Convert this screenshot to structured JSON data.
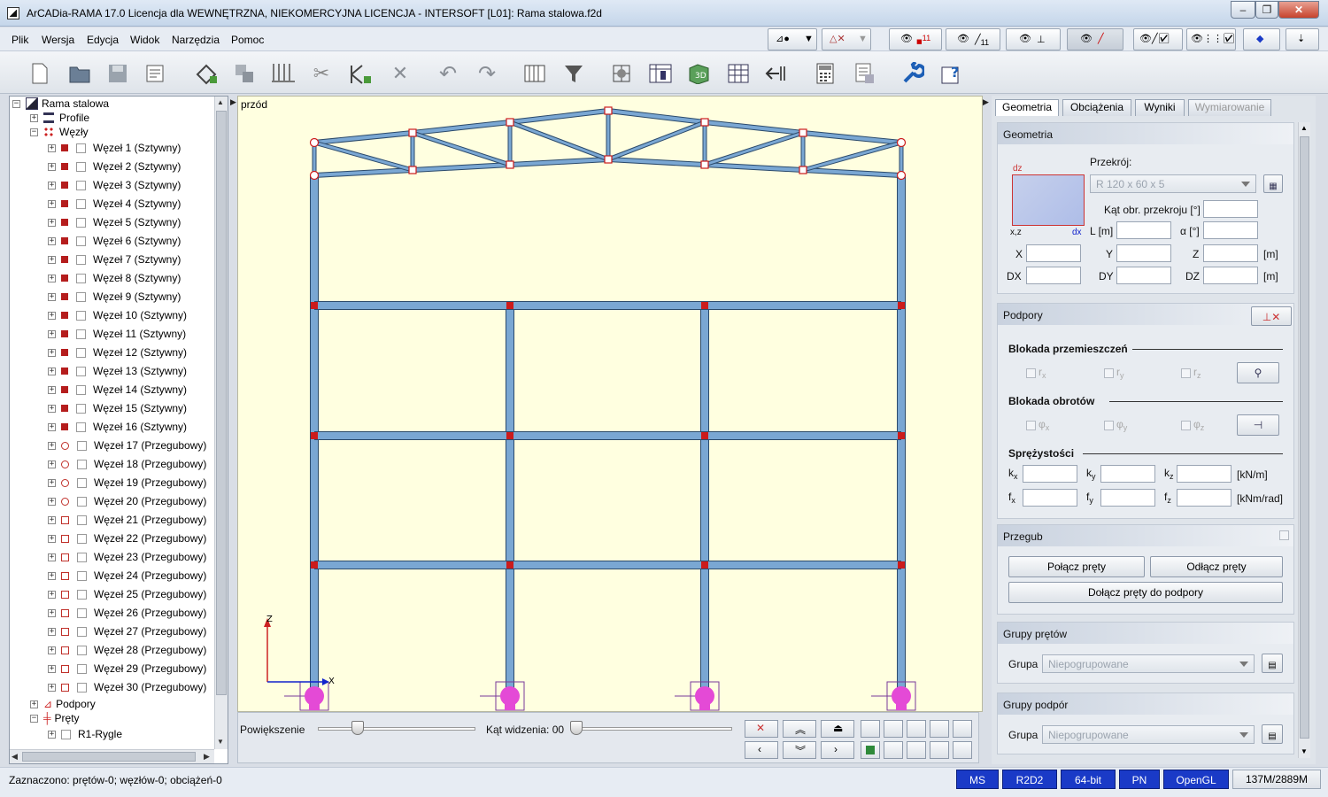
{
  "window": {
    "title": "ArCADia-RAMA 17.0 Licencja dla WEWNĘTRZNA, NIEKOMERCYJNA LICENCJA - INTERSOFT [L01]: Rama stalowa.f2d"
  },
  "menu": [
    "Plik",
    "Wersja",
    "Edycja",
    "Widok",
    "Narzędzia",
    "Pomoc"
  ],
  "tree": {
    "root": "Rama stalowa",
    "profile": "Profile",
    "wezly": "Węzły",
    "nodes": [
      "Węzeł 1 (Sztywny)",
      "Węzeł 2 (Sztywny)",
      "Węzeł 3 (Sztywny)",
      "Węzeł 4 (Sztywny)",
      "Węzeł 5 (Sztywny)",
      "Węzeł 6 (Sztywny)",
      "Węzeł 7 (Sztywny)",
      "Węzeł 8 (Sztywny)",
      "Węzeł 9 (Sztywny)",
      "Węzeł 10 (Sztywny)",
      "Węzeł 11 (Sztywny)",
      "Węzeł 12 (Sztywny)",
      "Węzeł 13 (Sztywny)",
      "Węzeł 14 (Sztywny)",
      "Węzeł 15 (Sztywny)",
      "Węzeł 16 (Sztywny)",
      "Węzeł 17 (Przegubowy)",
      "Węzeł 18 (Przegubowy)",
      "Węzeł 19 (Przegubowy)",
      "Węzeł 20 (Przegubowy)",
      "Węzeł 21 (Przegubowy)",
      "Węzeł 22 (Przegubowy)",
      "Węzeł 23 (Przegubowy)",
      "Węzeł 24 (Przegubowy)",
      "Węzeł 25 (Przegubowy)",
      "Węzeł 26 (Przegubowy)",
      "Węzeł 27 (Przegubowy)",
      "Węzeł 28 (Przegubowy)",
      "Węzeł 29 (Przegubowy)",
      "Węzeł 30 (Przegubowy)"
    ],
    "podpory": "Podpory",
    "prety": "Pręty",
    "rygle": "R1-Rygle"
  },
  "canvas": {
    "view_label": "przód",
    "axis_z": "Z",
    "axis_x": "X"
  },
  "bottom": {
    "zoom_label": "Powiększenie",
    "angle_label": "Kąt widzenia: 00"
  },
  "tabs": [
    "Geometria",
    "Obciążenia",
    "Wyniki",
    "Wymiarowanie"
  ],
  "geometria": {
    "header": "Geometria",
    "przekroj_label": "Przekrój:",
    "przekroj_value": "R 120 x 60 x 5",
    "dz": "dz",
    "xz": "x,z",
    "dx": "dx",
    "kat_label": "Kąt obr. przekroju [°]",
    "l_label": "L [m]",
    "alpha_label": "α [°]",
    "x": "X",
    "y": "Y",
    "z": "Z",
    "m1": "[m]",
    "DX": "DX",
    "DY": "DY",
    "DZ": "DZ",
    "m2": "[m]"
  },
  "podpory": {
    "header": "Podpory",
    "blokada_przem": "Blokada przemieszczeń",
    "rx": "r",
    "ry": "r",
    "rz": "r",
    "sx": "x",
    "sy": "y",
    "sz": "z",
    "blokada_obr": "Blokada obrotów",
    "phi": "φ",
    "sprezystosci": "Sprężystości",
    "k": "k",
    "f": "f",
    "kn_m": "[kN/m]",
    "knm_rad": "[kNm/rad]"
  },
  "przegub": {
    "header": "Przegub",
    "polacz": "Połącz pręty",
    "odlacz": "Odłącz pręty",
    "dolacz": "Dołącz pręty do podpory"
  },
  "grupy_pretow": {
    "header": "Grupy prętów",
    "label": "Grupa",
    "value": "Niepogrupowane"
  },
  "grupy_podpor": {
    "header": "Grupy podpór",
    "label": "Grupa",
    "value": "Niepogrupowane"
  },
  "status": {
    "text": "Zaznaczono: prętów-0; węzłów-0; obciążeń-0",
    "items": [
      "MS",
      "R2D2",
      "64-bit",
      "PN",
      "OpenGL"
    ],
    "memory": "137M/2889M"
  },
  "colors": {
    "frame": "#7aa7d3",
    "frame_edge": "#2b4a6b",
    "node_red": "#cc1b1b",
    "support": "#e44ad6",
    "canvas_bg": "#ffffe0",
    "status_blue": "#1a3ac7"
  }
}
